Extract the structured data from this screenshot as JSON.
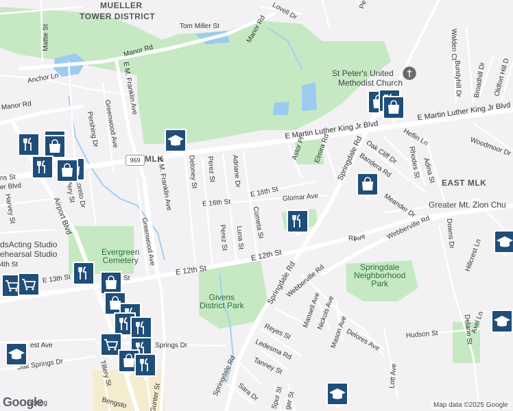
{
  "districts": {
    "mueller_line1": "MUELLER",
    "mueller_line2": "TOWER DISTRICT",
    "east_mlk": "EAST MLK",
    "mlk": "MLK"
  },
  "parks": {
    "evergreen_line1": "Evergreen",
    "evergreen_line2": "Cemetery",
    "givens_line1": "Givens",
    "givens_line2": "District Park",
    "springdale_line1": "Springdale",
    "springdale_line2": "Neighborhood",
    "springdale_line3": "Park",
    "tom_miller": "Tom Miller St"
  },
  "places": {
    "st_peters_line1": "St Peter's United",
    "st_peters_line2": "Methodist Church",
    "greater_mt_zion": "Greater Mt. Zion Chu",
    "studio_line1": "dsActing Studio",
    "studio_line2": "ehearsal Studio"
  },
  "route_shield": "969",
  "streets": {
    "lovell": "Lovell Dr",
    "mattie": "Mattie St",
    "manor_rd_n": "Manor Rd",
    "manor_rd_diag": "Manor Rd",
    "manor_rd_w": "Manor Rd",
    "anchor": "Anchor Ln",
    "em_franklin_n": "E M. Franklin Ave",
    "em_franklin_s": "E M. Franklin Ave",
    "greenwood_n": "Greenwood Ave",
    "greenwood_s": "Greenwood Ave",
    "pershing": "Pershing Dr",
    "mlk_blvd": "E Martin Luther King Jr Blvd",
    "mlk_short": "E Martin Luther King Jr Blvd",
    "deloney": "Deloney St",
    "perez_n": "Perez St",
    "perez_s": "Perez St",
    "adriane": "Adriane Dr",
    "luna": "Luna St",
    "cometa": "Cometa St",
    "e16_w": "E 16th St",
    "e16_e": "E 16th St",
    "astor": "Astor Pl",
    "elmira": "Elmira Rd",
    "springdale_n": "Springdale Rd",
    "springdale_s": "Springdale Rd",
    "springdale_sw": "Springdale Rd",
    "glomar": "Glomar Ave",
    "oak_cliff": "Oak Cliff Dr",
    "bandera": "Bandera Rd",
    "rhodes": "Rhodes St",
    "adina": "Adina St",
    "heflin": "Heflin Ln",
    "meander": "Meander Dr",
    "webberville": "Webberville Rd",
    "webberville2": "Webberville Rd",
    "e12": "E 12th St",
    "e12_e": "E 12th St",
    "e13": "E 13th St",
    "airport": "Airport Blvd",
    "harvey": "Harvey St",
    "walden": "Walden Ct",
    "bundyhill": "Bundyhill Dr",
    "broadhill": "Broadhill Dr",
    "oldfort": "Oldfort Hill D",
    "woodmoor": "Woodmoor Dr",
    "downs": "Downs Dr",
    "hillcrest": "Hillcrest Ln",
    "delano": "Delano St",
    "axel": "Axel Ln",
    "hudson": "Hudson St",
    "mansell": "Mansell Ave",
    "nickols": "Nickols Ave",
    "mason": "Mason Ave",
    "delores": "Delores Ave",
    "lott": "Lott Ave",
    "reyes": "Reyes St",
    "ledesma": "Ledesma Rd",
    "tanney": "Tanney St",
    "sara": "Sara Dr",
    "spur": "Spur St",
    "gunter": "Gunter St",
    "tillery": "Tillery St",
    "bengston": "Bengsto",
    "oak_springs": "Oak Springs Dr",
    "springs_dr": "Springs Dr",
    "est_ave": "est Ave",
    "loreto": "Loreto Dr",
    "tillery_n": "Tillery St",
    "st_frag": "St",
    "ns_st": "ns St",
    "er_blvd": "er Blvd",
    "th_st": "4th St",
    "ri_ave": "Ri",
    "ave_frag": "Ave",
    "pe_frag": "Pe",
    "spring_frag": "Spring",
    "prog_frag": "ger St"
  },
  "attribution": "Map data ©2025 Google",
  "logo": "Google",
  "colors": {
    "park": "#c6e9c4",
    "water": "#9ccbef",
    "road": "#ffffff",
    "stream": "#9fd0f0",
    "pin": "#1f4e79",
    "background": "#f3f1f4"
  },
  "pins": [
    {
      "icon": "school-icon"
    },
    {
      "icon": "restaurant-icon"
    },
    {
      "icon": "restaurant-icon"
    },
    {
      "icon": "shopping-icon"
    },
    {
      "icon": "shopping-icon"
    },
    {
      "icon": "restaurant-icon"
    },
    {
      "icon": "shopping-icon"
    },
    {
      "icon": "shopping-icon"
    },
    {
      "icon": "shopping-icon"
    },
    {
      "icon": "restaurant-icon"
    },
    {
      "icon": "shopping-icon"
    },
    {
      "icon": "grocery-icon"
    },
    {
      "icon": "grocery-icon"
    },
    {
      "icon": "restaurant-icon"
    },
    {
      "icon": "shopping-icon"
    },
    {
      "icon": "shopping-icon"
    },
    {
      "icon": "restaurant-icon"
    },
    {
      "icon": "restaurant-icon"
    },
    {
      "icon": "restaurant-icon"
    },
    {
      "icon": "grocery-icon"
    },
    {
      "icon": "restaurant-icon"
    },
    {
      "icon": "shopping-icon"
    },
    {
      "icon": "restaurant-icon"
    },
    {
      "icon": "school-icon"
    },
    {
      "icon": "restaurant-icon"
    },
    {
      "icon": "school-icon"
    },
    {
      "icon": "school-icon"
    },
    {
      "icon": "school-icon"
    },
    {
      "icon": "church-icon"
    }
  ]
}
